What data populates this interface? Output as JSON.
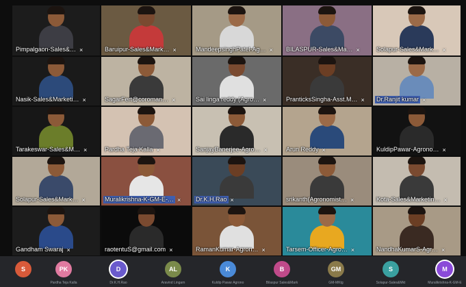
{
  "tiles": [
    {
      "label": "Pimpalgaon-Sales&…",
      "bg": "#1c1c1c",
      "skin": "#8c5a38",
      "shirt": "#3d3d44",
      "person": true
    },
    {
      "label": "Baruipur-Sales&Mark…",
      "bg": "#6b5a42",
      "skin": "#7a4a30",
      "shirt": "#c43a3a",
      "person": true
    },
    {
      "label": "MandeepsinghPatel-Ag…",
      "bg": "#a59a86",
      "skin": "#9b6a48",
      "shirt": "#d8d8d8",
      "person": true
    },
    {
      "label": "BILASPUR-Sales&Ma…",
      "bg": "#8a6f84",
      "skin": "#8c5a38",
      "shirt": "#3c4a64",
      "person": true
    },
    {
      "label": "Solapur-Sales&Mark…",
      "bg": "#d8c8b8",
      "skin": "#9b6a48",
      "shirt": "#2a3a5a",
      "person": true
    },
    {
      "label": "Nasik-Sales&Marketi…",
      "bg": "#1a1a1a",
      "skin": "#8c5a38",
      "shirt": "#2c4a7a",
      "person": true
    },
    {
      "label": "SagarFert@coroman…",
      "bg": "#bdb3a2",
      "skin": "#8c5a38",
      "shirt": "#3a3a3a",
      "person": true
    },
    {
      "label": "Sai linga reddy (Agro…",
      "bg": "#6a6a6a",
      "skin": "#7a4a30",
      "shirt": "#e0e0e0",
      "person": true
    },
    {
      "label": "PranticksSingha-Asst.M…",
      "bg": "#3a2e26",
      "skin": "#6b3e24",
      "shirt": "#3a3a3a",
      "person": true
    },
    {
      "label": "Dr.Ranjit kumar",
      "bg": "#b8b0a4",
      "skin": "#9b6a48",
      "shirt": "#6a8cba",
      "person": true
    },
    {
      "label": "Tarakeswar-Sales&M…",
      "bg": "#171717",
      "skin": "#8c5a38",
      "shirt": "#6b7d2a",
      "person": true
    },
    {
      "label": "Pardha Teja Kalla",
      "bg": "#d4c2b2",
      "skin": "#8c5a38",
      "shirt": "#6a6a72",
      "person": true
    },
    {
      "label": "SanjayBanerjee-Agro…",
      "bg": "#c8c0b2",
      "skin": "#8c5a38",
      "shirt": "#2a2a2a",
      "person": true
    },
    {
      "label": "Arun Reddy",
      "bg": "#b4a48e",
      "skin": "#9b6a48",
      "shirt": "#2a4a7a",
      "person": true
    },
    {
      "label": "KuldipPawar-Agrono…",
      "bg": "#121212",
      "skin": "#8c5a38",
      "shirt": "#2a2a2a",
      "person": true
    },
    {
      "label": "Solapur-Sales&Mark…",
      "bg": "#b2a898",
      "skin": "#8c5a38",
      "shirt": "#3a4a6a",
      "person": true
    },
    {
      "label": "Muralikrishna-K-GM-E-…",
      "bg": "#8a5040",
      "skin": "#8c5a38",
      "shirt": "#e6e6e6",
      "person": true
    },
    {
      "label": "Dr.K.H.Rao",
      "bg": "#3a4a58",
      "skin": "#6b3e24",
      "shirt": "#3a3a3a",
      "person": true
    },
    {
      "label": "srikanth(Agronomist…",
      "bg": "#9a8c7c",
      "skin": "#8c5a38",
      "shirt": "#3a3a3a",
      "person": true
    },
    {
      "label": "Kota-Sales&Marketin…",
      "bg": "#c4bcb0",
      "skin": "#7a4a30",
      "shirt": "#3a3a3a",
      "person": true
    },
    {
      "label": "Gandham Swaraj",
      "bg": "#1c1c1c",
      "skin": "#8c5a38",
      "shirt": "#2a4a8a",
      "person": true
    },
    {
      "label": "raotentuS@gmail.com",
      "bg": "#0b0b0b",
      "skin": "#7a4a30",
      "shirt": "#2a2a2a",
      "person": true
    },
    {
      "label": "RamanKumar-Agron…",
      "bg": "#7a5438",
      "skin": "#8c5a38",
      "shirt": "#e0e0e0",
      "person": true
    },
    {
      "label": "Tarsem-Officer-Agro…",
      "bg": "#2a8a9a",
      "skin": "#9b6a48",
      "shirt": "#e8a820",
      "person": true
    },
    {
      "label": "NandhaKumarS-Agr…",
      "bg": "#a89a86",
      "skin": "#6b3e24",
      "shirt": "#3a2a22",
      "person": true
    }
  ],
  "highlighted": [
    9,
    16,
    17
  ],
  "participants": [
    {
      "initials": "S",
      "label": "",
      "color": "#d85a3a",
      "selected": false
    },
    {
      "initials": "PK",
      "label": "Pardha Teja Kalla",
      "color": "#e07aa0",
      "selected": false
    },
    {
      "initials": "D",
      "label": "Dr.K.H.Rao",
      "color": "#6a5acd",
      "selected": true
    },
    {
      "initials": "AL",
      "label": "Aravind Lingam",
      "color": "#7a8a4a",
      "selected": false
    },
    {
      "initials": "K",
      "label": "Kuldip Pawar Agrono",
      "color": "#4a8ad8",
      "selected": false
    },
    {
      "initials": "B",
      "label": "Bilaspur Sales&Mark",
      "color": "#c04a8a",
      "selected": false
    },
    {
      "initials": "GM",
      "label": "GM-MKtg",
      "color": "#8a7a4a",
      "selected": false
    },
    {
      "initials": "S",
      "label": "Solapur-Sales&Mkt",
      "color": "#3aa0a0",
      "selected": false
    },
    {
      "initials": "M",
      "label": "Muralikrishna-K-GM-E",
      "color": "#8a4ad8",
      "selected": true
    }
  ]
}
